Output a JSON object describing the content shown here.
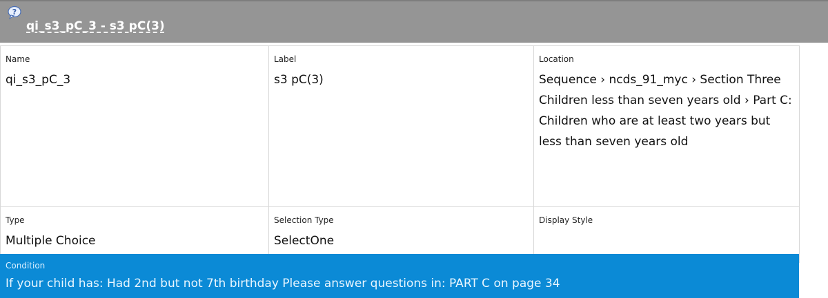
{
  "header": {
    "title": "qi_s3_pC_3 - s3 pC(3)",
    "icon": "question-icon"
  },
  "fields": {
    "name": {
      "label": "Name",
      "value": "qi_s3_pC_3"
    },
    "label": {
      "label": "Label",
      "value": "s3 pC(3)"
    },
    "location": {
      "label": "Location",
      "value": "Sequence › ncds_91_myc › Section Three Children less than seven years old › Part C: Children who are at least two years but less than seven years old"
    },
    "type": {
      "label": "Type",
      "value": "Multiple Choice"
    },
    "selection_type": {
      "label": "Selection Type",
      "value": "SelectOne"
    },
    "display_style": {
      "label": "Display Style",
      "value": ""
    }
  },
  "condition": {
    "label": "Condition",
    "value": "If your child has: Had 2nd but not 7th birthday Please answer questions in: PART C on page 34"
  },
  "colors": {
    "header_bg": "#959595",
    "condition_bg": "#0b8ad6"
  }
}
